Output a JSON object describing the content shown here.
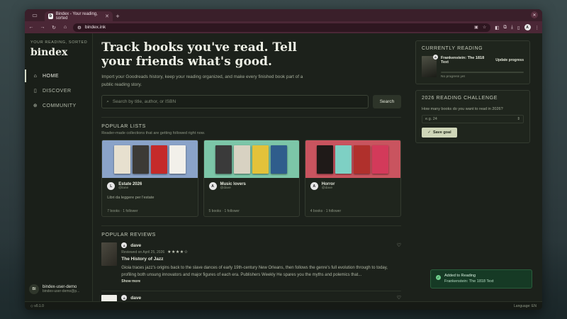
{
  "browser": {
    "tab_title": "Bindex - Your reading, sorted",
    "tab_favicon": "b",
    "url": "bindex.ink",
    "new_tab_symbol": "+",
    "profile_initial": "A"
  },
  "sidebar": {
    "tagline": "YOUR READING, SORTED",
    "brand": "bindex",
    "items": [
      {
        "label": "HOME",
        "icon": "home-icon",
        "active": true
      },
      {
        "label": "DISCOVER",
        "icon": "book-icon",
        "active": false
      },
      {
        "label": "COMMUNITY",
        "icon": "globe-icon",
        "active": false
      }
    ],
    "user": {
      "initials": "BI",
      "name": "bindex-user-demo",
      "email": "bindex-user-demo@p..."
    }
  },
  "hero": {
    "title": "Track books you've read. Tell your friends what's good.",
    "subtitle": "Import your Goodreads history, keep your reading organized, and make every finished book part of a public reading story."
  },
  "search": {
    "placeholder": "Search by title, author, or ISBN",
    "button": "Search"
  },
  "popular_lists": {
    "title": "POPULAR LISTS",
    "subtitle": "Reader-made collections that are getting followed right now.",
    "cards": [
      {
        "name": "Estate 2026",
        "handle": "@lane",
        "avatar": "L",
        "description": "Libri da leggere per l'estate",
        "meta": "7 books · 1 follower",
        "band": "#8aa3c9"
      },
      {
        "name": "Music lovers",
        "handle": "@dave",
        "avatar": "A",
        "description": "",
        "meta": "5 books · 1 follower",
        "band": "#7cc6a8"
      },
      {
        "name": "Horror",
        "handle": "@dave",
        "avatar": "A",
        "description": "",
        "meta": "4 books · 1 follower",
        "band": "#c9545f"
      }
    ]
  },
  "popular_reviews": {
    "title": "POPULAR REVIEWS",
    "items": [
      {
        "user": "dave",
        "avatar": "A",
        "meta": "Reviewed on April 25, 2026",
        "stars": "★★★★☆",
        "book": "The History of Jazz",
        "text": "Gioia traces jazz's origins back to the slave dances of early 19th-century New Orleans, then follows the genre's full evolution through to today, profiling both unsung innovators and major figures of each era. Publishers Weekly He spares you the myths and polemics that...",
        "show_more": "Show more"
      },
      {
        "user": "dave",
        "avatar": "A"
      }
    ]
  },
  "currently_reading": {
    "title": "CURRENTLY READING",
    "book": "Frankenstein: The 1818 Text",
    "update_label": "Update progress",
    "progress_label": "No progress yet",
    "progress": 0,
    "badge": "A"
  },
  "challenge": {
    "title": "2026 READING CHALLENGE",
    "question": "How many books do you want to read in 2026?",
    "placeholder": "e.g. 24",
    "save_label": "Save goal",
    "save_icon": "✓"
  },
  "toast": {
    "line1": "Added to Reading",
    "line2": "Frankenstein: The 1818 Text",
    "icon": "✓"
  },
  "footer": {
    "version": "v0.1.0",
    "language": "Language: EN"
  }
}
